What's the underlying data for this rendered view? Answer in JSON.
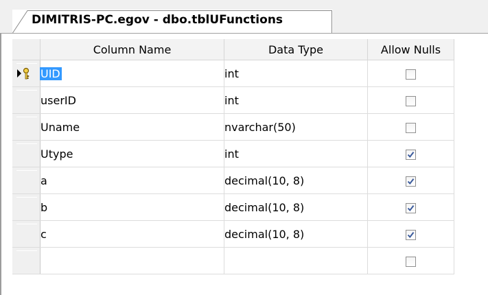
{
  "tab": {
    "title": "DIMITRIS-PC.egov - dbo.tblUFunctions"
  },
  "columns": {
    "name": "Column Name",
    "type": "Data Type",
    "nulls": "Allow Nulls"
  },
  "rows": [
    {
      "name": "UID",
      "type": "int",
      "allow_nulls": false,
      "primary_key": true,
      "selected": true
    },
    {
      "name": "userID",
      "type": "int",
      "allow_nulls": false
    },
    {
      "name": "Uname",
      "type": "nvarchar(50)",
      "allow_nulls": false
    },
    {
      "name": "Utype",
      "type": "int",
      "allow_nulls": true
    },
    {
      "name": "a",
      "type": "decimal(10, 8)",
      "allow_nulls": true
    },
    {
      "name": "b",
      "type": "decimal(10, 8)",
      "allow_nulls": true
    },
    {
      "name": "c",
      "type": "decimal(10, 8)",
      "allow_nulls": true
    },
    {
      "name": "",
      "type": "",
      "allow_nulls": false
    }
  ],
  "icons": {
    "primary_key": "row-indicator-key-icon",
    "checkbox_checked": "check-icon"
  },
  "colors": {
    "selection": "#3399ff",
    "check": "#3a5a9c"
  }
}
